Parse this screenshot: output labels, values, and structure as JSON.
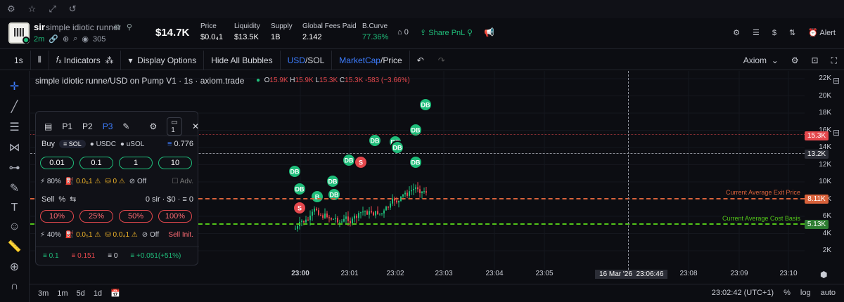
{
  "header": {
    "ticker": "sir",
    "name": "simple idiotic runner",
    "age": "2m",
    "holders": "305",
    "market_cap": "$14.7K",
    "stats": [
      {
        "label": "Price",
        "value": "$0.0₄1"
      },
      {
        "label": "Liquidity",
        "value": "$13.5K"
      },
      {
        "label": "Supply",
        "value": "1B"
      },
      {
        "label": "Global Fees Paid",
        "value": "2.142"
      },
      {
        "label": "B.Curve",
        "value": "77.36%"
      }
    ],
    "watch_count": "0",
    "share_label": "Share PnL",
    "alert_label": "Alert"
  },
  "toolbar": {
    "interval": "1s",
    "indicators": "Indicators",
    "display_options": "Display Options",
    "hide_bubbles": "Hide All Bubbles",
    "usd": "USD",
    "sol": "/SOL",
    "marketcap": "MarketCap",
    "price": "/Price",
    "axiom": "Axiom"
  },
  "chart": {
    "title": "simple idiotic runne/USD on Pump V1 · 1s · axiom.trade",
    "ohlc": {
      "o": "15.9K",
      "h": "15.9K",
      "l": "15.3K",
      "c": "15.3K",
      "change": "-583 (−3.66%)"
    },
    "price_labels": [
      "22K",
      "20K",
      "18K",
      "16K",
      "14K",
      "12K",
      "10K",
      "8K",
      "6K",
      "4K",
      "2K"
    ],
    "tags": {
      "current": "15.3K",
      "crosshair": "13.2K",
      "exit": "8.11K",
      "cost": "5.13K"
    },
    "lines": {
      "exit_label": "Current Average Exit Price",
      "cost_label": "Current Average Cost Basis"
    },
    "time_labels": [
      "23:00",
      "23:01",
      "23:02",
      "23:03",
      "23:04",
      "23:05",
      "23:08",
      "23:09",
      "23:10"
    ],
    "crosshair_date": "16 Mar '26",
    "crosshair_time": "23:06:46",
    "colors": {
      "up": "#1fbd7a",
      "down": "#e5484d",
      "exit": "#d9623b",
      "cost": "#52c41a"
    },
    "bubbles": [
      "DB",
      "DB",
      "DB",
      "DB",
      "S",
      "S",
      "B",
      "DB",
      "DB",
      "DB"
    ]
  },
  "trade_panel": {
    "tabs": [
      "P1",
      "P2",
      "P3"
    ],
    "active_tab": "P3",
    "count": "1",
    "buy_label": "Buy",
    "buy_tokens": [
      "SOL",
      "USDC",
      "uSOL"
    ],
    "sol_balance": "0.776",
    "buy_amounts": [
      "0.01",
      "0.1",
      "1",
      "10"
    ],
    "buy_settings": {
      "slip": "80%",
      "prio": "0.0₅1",
      "bribe": "0",
      "auto": "Off",
      "adv": "Adv."
    },
    "sell_label": "Sell",
    "sell_unit": "%",
    "sell_holdings": "0 sir · $0 · ≡ 0",
    "sell_pcts": [
      "10%",
      "25%",
      "50%",
      "100%"
    ],
    "sell_settings": {
      "slip": "40%",
      "prio": "0.0₅1",
      "bribe": "0.0₄1",
      "auto": "Off",
      "init": "Sell Init."
    },
    "footer": [
      "0.1",
      "0.151",
      "0",
      "+0.051(+51%)"
    ]
  },
  "bottom": {
    "ranges": [
      "3m",
      "1m",
      "5d",
      "1d"
    ],
    "clock": "23:02:42 (UTC+1)",
    "pct": "%",
    "log": "log",
    "auto": "auto"
  }
}
